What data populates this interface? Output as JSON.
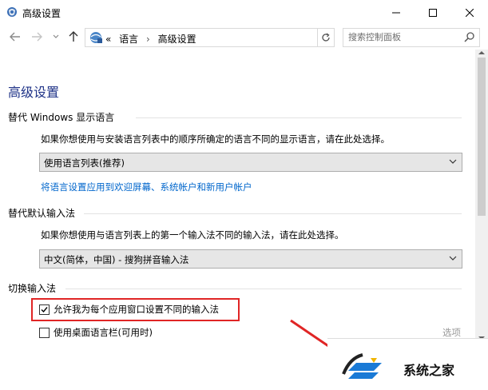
{
  "window": {
    "title": "高级设置"
  },
  "nav": {
    "back_icon": "back-arrow-icon",
    "forward_icon": "forward-arrow-icon",
    "up_icon": "up-arrow-icon",
    "address": {
      "overflow": "«",
      "crumb_1": "语言",
      "separator": "›",
      "crumb_2": "高级设置"
    },
    "search_placeholder": "搜索控制面板"
  },
  "page": {
    "title": "高级设置",
    "display_language": {
      "header": "替代 Windows 显示语言",
      "description": "如果你想使用与安装语言列表中的顺序所确定的语言不同的显示语言，请在此处选择。",
      "selected": "使用语言列表(推荐)",
      "link": "将语言设置应用到欢迎屏幕、系统帐户和新用户帐户"
    },
    "input_method": {
      "header": "替代默认输入法",
      "description": "如果你想使用与语言列表上的第一个输入法不同的输入法，请在此处选择。",
      "selected": "中文(简体，中国) - 搜狗拼音输入法"
    },
    "switch_input": {
      "header": "切换输入法",
      "per_app_label": "允许我为每个应用窗口设置不同的输入法",
      "per_app_checked": true,
      "language_bar_label": "使用桌面语言栏(可用时)",
      "language_bar_checked": false,
      "options_link": "选项"
    }
  },
  "watermark": {
    "text": "系统之家"
  },
  "colors": {
    "title_blue": "#1e3287",
    "link_blue": "#0066cc",
    "highlight_red": "#e02525"
  }
}
